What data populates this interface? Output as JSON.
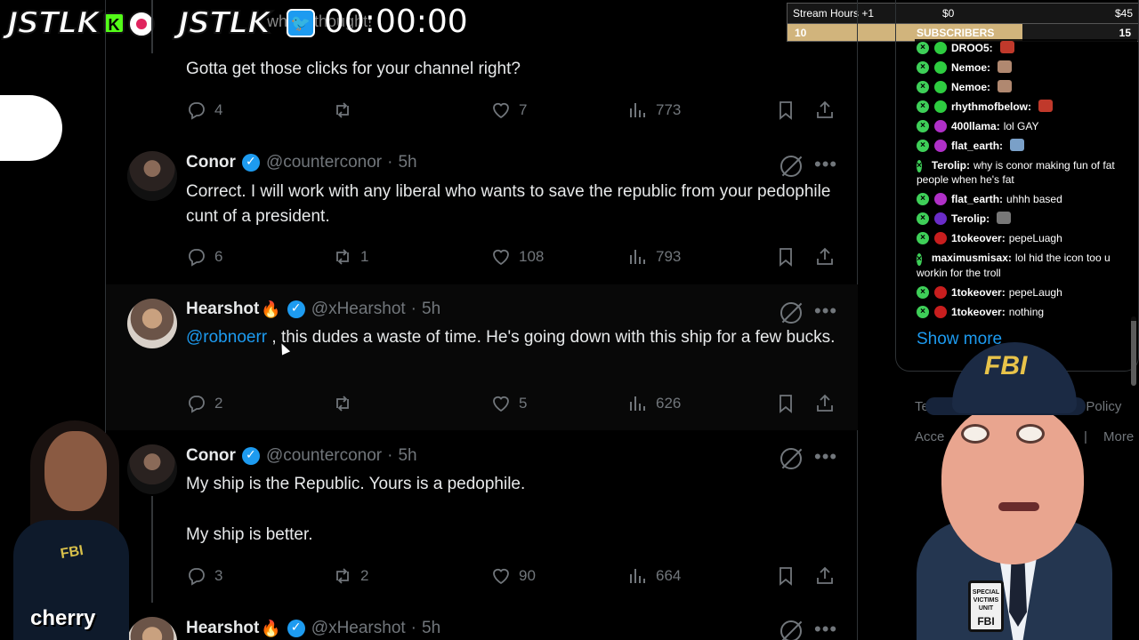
{
  "overlay": {
    "logo_left": "JSTLK",
    "logo_k": "K",
    "logo_right": "JSTLK",
    "timer": "00:00:00",
    "ghost_text": "what I thought!",
    "cherry_label": "cherry",
    "mascot_cap": "FBI",
    "mascot_badge": "SPECIAL VICTIMS UNIT",
    "mascot_badge_fbi": "FBI",
    "cherry_fbi": "FBI"
  },
  "stream_stats": {
    "label": "Stream Hours +1",
    "amount_left": "$0",
    "amount_right": "$45",
    "bar_left": "10",
    "bar_label": "SUBSCRIBERS",
    "bar_right": "15",
    "progress_fraction": 0.67
  },
  "tweets": [
    {
      "text": "Gotta get those clicks for your channel right?",
      "replies": "4",
      "retweets": "",
      "likes": "7",
      "views": "773"
    },
    {
      "name": "Conor",
      "handle": "@counterconor",
      "time": "5h",
      "text": "Correct. I will work with any liberal who wants to save the republic from your pedophile cunt of a president.",
      "replies": "6",
      "retweets": "1",
      "likes": "108",
      "views": "793"
    },
    {
      "name": "Hearshot",
      "emoji": "🔥",
      "handle": "@xHearshot",
      "time": "5h",
      "mention": "@robnoerr",
      "text": " , this dudes a waste of time. He's going down with this ship for a few bucks.",
      "replies": "2",
      "retweets": "",
      "likes": "5",
      "views": "626"
    },
    {
      "name": "Conor",
      "handle": "@counterconor",
      "time": "5h",
      "text_line1": "My ship is the Republic. Yours is a pedophile.",
      "text_line2": "My ship is better.",
      "replies": "3",
      "retweets": "2",
      "likes": "90",
      "views": "664"
    },
    {
      "name": "Hearshot",
      "emoji": "🔥",
      "handle": "@xHearshot",
      "time": "5h"
    }
  ],
  "sidebar": {
    "show_more": "Show more",
    "footer": [
      "Terms",
      "ivacy Policy",
      "Acce",
      "o",
      "|",
      "More"
    ]
  },
  "chat": [
    {
      "user": "DROO5:",
      "msg": "",
      "badge_color": "#2ecc40",
      "emote_color": "#c0392b"
    },
    {
      "user": "Nemoe:",
      "msg": "",
      "badge_color": "#2ecc40",
      "emote_color": "#b08870"
    },
    {
      "user": "Nemoe:",
      "msg": "",
      "badge_color": "#2ecc40",
      "emote_color": "#b08870"
    },
    {
      "user": "rhythmofbelow:",
      "msg": "",
      "badge_color": "#2ecc40",
      "emote_color": "#c0392b"
    },
    {
      "user": "400llama:",
      "msg": "lol GAY",
      "badge_color": "#b030c8",
      "emote_color": ""
    },
    {
      "user": "flat_earth:",
      "msg": "",
      "badge_color": "#b030c8",
      "emote_color": "#7aa0c8"
    },
    {
      "user": "Terolip:",
      "msg": "why is conor making fun of fat people when he's fat",
      "badge_color": "#6a2cc8",
      "emote_color": ""
    },
    {
      "user": "flat_earth:",
      "msg": "uhhh based",
      "badge_color": "#b030c8",
      "emote_color": ""
    },
    {
      "user": "Terolip:",
      "msg": "",
      "badge_color": "#6a2cc8",
      "emote_color": "#777777"
    },
    {
      "user": "1tokeover:",
      "msg": "pepeLuagh",
      "badge_color": "#c81e1e",
      "emote_color": ""
    },
    {
      "user": "maximusmisax:",
      "msg": "lol hid the icon too u workin for the troll",
      "badge_color": "#2ecc40",
      "emote_color": ""
    },
    {
      "user": "1tokeover:",
      "msg": "pepeLaugh",
      "badge_color": "#c81e1e",
      "emote_color": ""
    },
    {
      "user": "1tokeover:",
      "msg": "nothing",
      "badge_color": "#c81e1e",
      "emote_color": ""
    }
  ],
  "colors": {
    "accent": "#1d9bf0",
    "muted": "#71767b",
    "text": "#e7e9ea",
    "border": "#2f3336",
    "subs_bar": "#d1b47c"
  },
  "icons": [
    "reply-icon",
    "retweet-icon",
    "like-icon",
    "views-icon",
    "bookmark-icon",
    "share-icon",
    "grok-icon",
    "more-icon",
    "verified-icon"
  ]
}
